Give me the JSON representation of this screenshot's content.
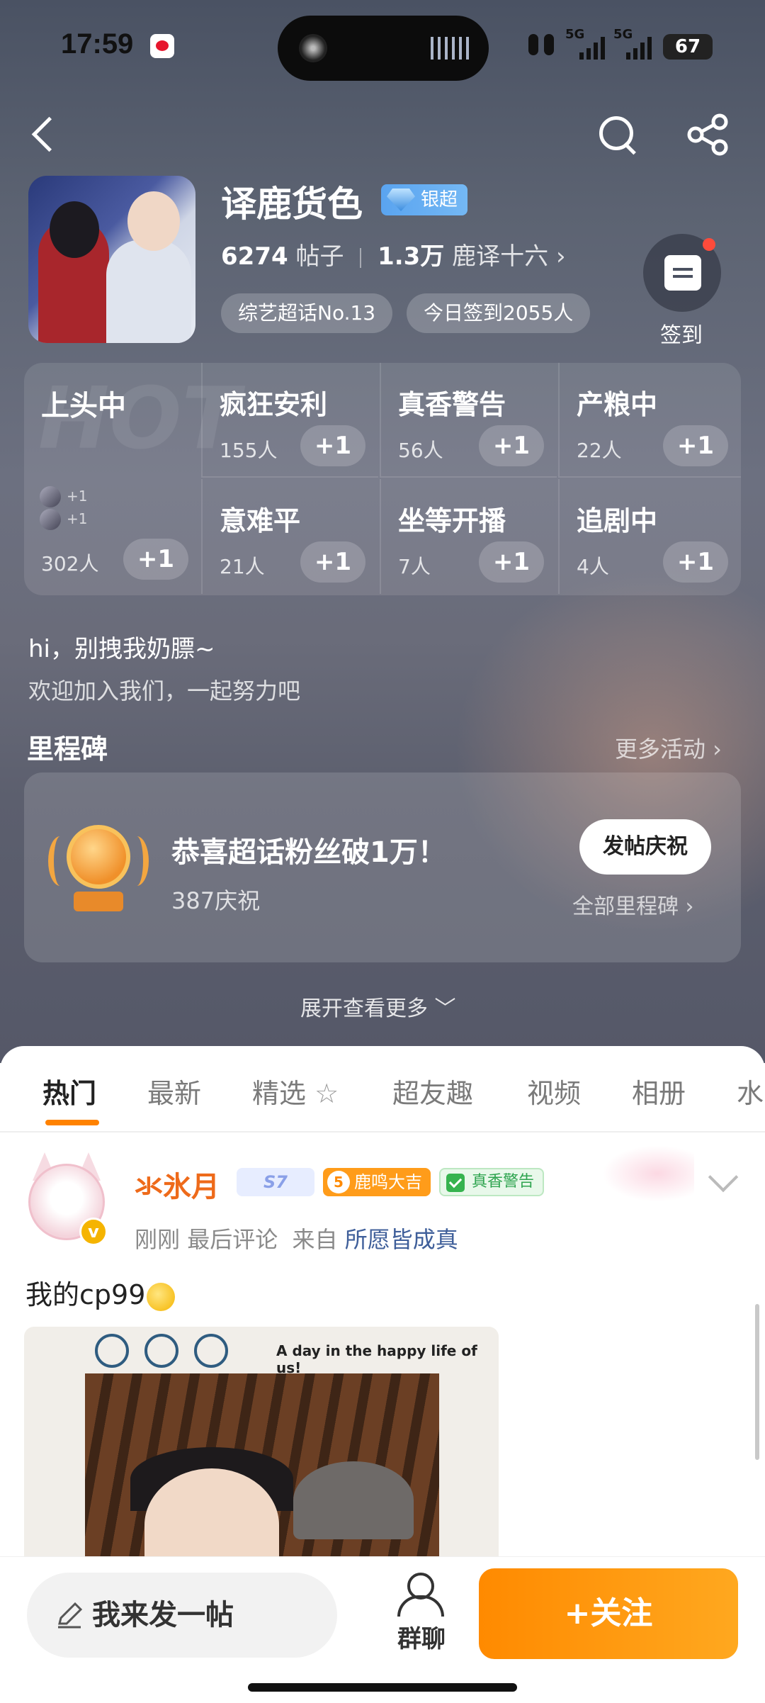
{
  "status_bar": {
    "time": "17:59",
    "signal1": "5G",
    "signal2": "5G",
    "battery": "67"
  },
  "header": {
    "title": "译鹿货色",
    "badge": "银超",
    "posts_count": "6274",
    "posts_label": "帖子",
    "fans_count": "1.3万",
    "fans_name": "鹿译十六",
    "chips": [
      "综艺超话No.13",
      "今日签到2055人"
    ],
    "checkin_label": "签到"
  },
  "mood": {
    "lead": {
      "name": "上头中",
      "count": "302人",
      "plus_a": "+1",
      "plus_b": "+1"
    },
    "items": [
      {
        "name": "疯狂安利",
        "count": "155人"
      },
      {
        "name": "真香警告",
        "count": "56人"
      },
      {
        "name": "产粮中",
        "count": "22人"
      },
      {
        "name": "意难平",
        "count": "21人"
      },
      {
        "name": "坐等开播",
        "count": "7人"
      },
      {
        "name": "追剧中",
        "count": "4人"
      }
    ],
    "plus_label": "+1",
    "bg_text": "HOT"
  },
  "intro": {
    "line1": "hi，别拽我奶膘~",
    "line2": "欢迎加入我们，一起努力吧"
  },
  "milestone": {
    "title": "里程碑",
    "more": "更多活动 ›",
    "text": "恭喜超话粉丝破1万！",
    "sub": "387庆祝",
    "button": "发帖庆祝",
    "all": "全部里程碑 ›"
  },
  "expand_label": "展开查看更多 ﹀",
  "tabs": [
    "热门",
    "最新",
    "精选",
    "超友趣",
    "视频",
    "相册",
    "水"
  ],
  "post": {
    "user": "氺氷月",
    "level": "S7",
    "tag1_num": "5",
    "tag1": "鹿鸣大吉",
    "tag2": "真香警告",
    "time": "刚刚",
    "action": "最后评论",
    "from_label": "来自",
    "source": "所愿皆成真",
    "text": "我的cp99",
    "image_caption": "A day in the happy life of us!"
  },
  "bottom": {
    "compose": "我来发一帖",
    "group": "群聊",
    "follow": "+关注"
  },
  "colors": {
    "accent": "#ff8200",
    "username": "#ee6a1a",
    "link": "#3f5f9a"
  }
}
